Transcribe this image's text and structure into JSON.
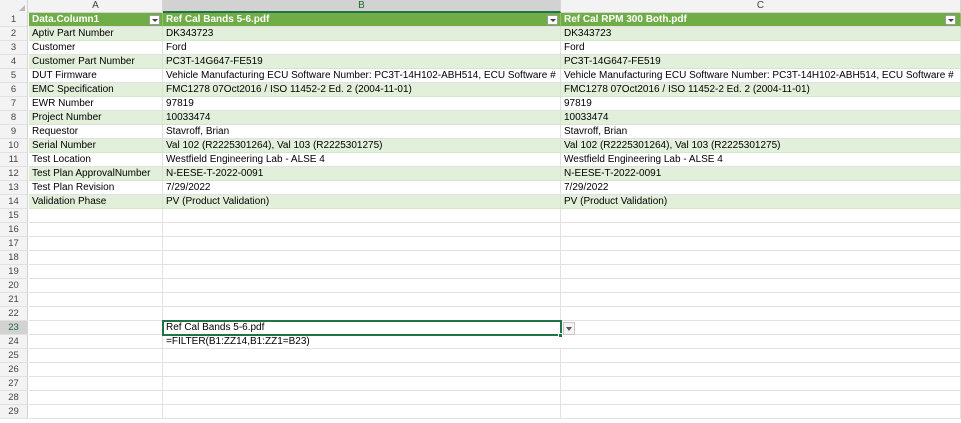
{
  "columns": [
    "A",
    "B",
    "C"
  ],
  "active_cell": {
    "ref": "B23",
    "row": "23",
    "column": "B"
  },
  "header_row": {
    "row_number": "1",
    "a": "Data.Column1",
    "b": "Ref Cal Bands 5-6.pdf",
    "c": "Ref Cal RPM 300 Both.pdf"
  },
  "rows": [
    {
      "n": "2",
      "a": "Aptiv Part Number",
      "b": "DK343723",
      "c": "DK343723"
    },
    {
      "n": "3",
      "a": "Customer",
      "b": "Ford",
      "c": "Ford"
    },
    {
      "n": "4",
      "a": "Customer Part Number",
      "b": "PC3T-14G647-FE519",
      "c": "PC3T-14G647-FE519"
    },
    {
      "n": "5",
      "a": "DUT Firmware",
      "b": "Vehicle Manufacturing ECU Software Number: PC3T-14H102-ABH514, ECU Software #",
      "c": "Vehicle Manufacturing ECU Software Number: PC3T-14H102-ABH514, ECU Software #"
    },
    {
      "n": "6",
      "a": "EMC Specification",
      "b": "FMC1278 07Oct2016 / ISO 11452-2 Ed. 2 (2004-11-01)",
      "c": "FMC1278 07Oct2016 / ISO 11452-2 Ed. 2 (2004-11-01)"
    },
    {
      "n": "7",
      "a": "EWR Number",
      "b": "97819",
      "c": "97819"
    },
    {
      "n": "8",
      "a": "Project Number",
      "b": "10033474",
      "c": "10033474"
    },
    {
      "n": "9",
      "a": "Requestor",
      "b": "Stavroff, Brian",
      "c": "Stavroff, Brian"
    },
    {
      "n": "10",
      "a": "Serial Number",
      "b": "Val 102 (R2225301264), Val 103 (R2225301275)",
      "c": "Val 102 (R2225301264), Val 103 (R2225301275)"
    },
    {
      "n": "11",
      "a": "Test Location",
      "b": "Westfield Engineering Lab - ALSE 4",
      "c": "Westfield Engineering Lab - ALSE 4"
    },
    {
      "n": "12",
      "a": "Test Plan ApprovalNumber",
      "b": "N-EESE-T-2022-0091",
      "c": "N-EESE-T-2022-0091"
    },
    {
      "n": "13",
      "a": "Test Plan Revision",
      "b": "7/29/2022",
      "c": "7/29/2022"
    },
    {
      "n": "14",
      "a": "Validation Phase",
      "b": "PV (Product Validation)",
      "c": "PV (Product Validation)"
    }
  ],
  "empty_rows": [
    "15",
    "16",
    "17",
    "18",
    "19",
    "20",
    "21",
    "22",
    "23",
    "24",
    "25",
    "26",
    "27",
    "28",
    "29"
  ],
  "cell_b23": "Ref Cal Bands 5-6.pdf",
  "cell_b24": "=FILTER(B1:ZZ14,B1:ZZ1=B23)",
  "colors": {
    "header_green": "#70ad47",
    "band_green": "#e2efda",
    "selection": "#217346"
  }
}
